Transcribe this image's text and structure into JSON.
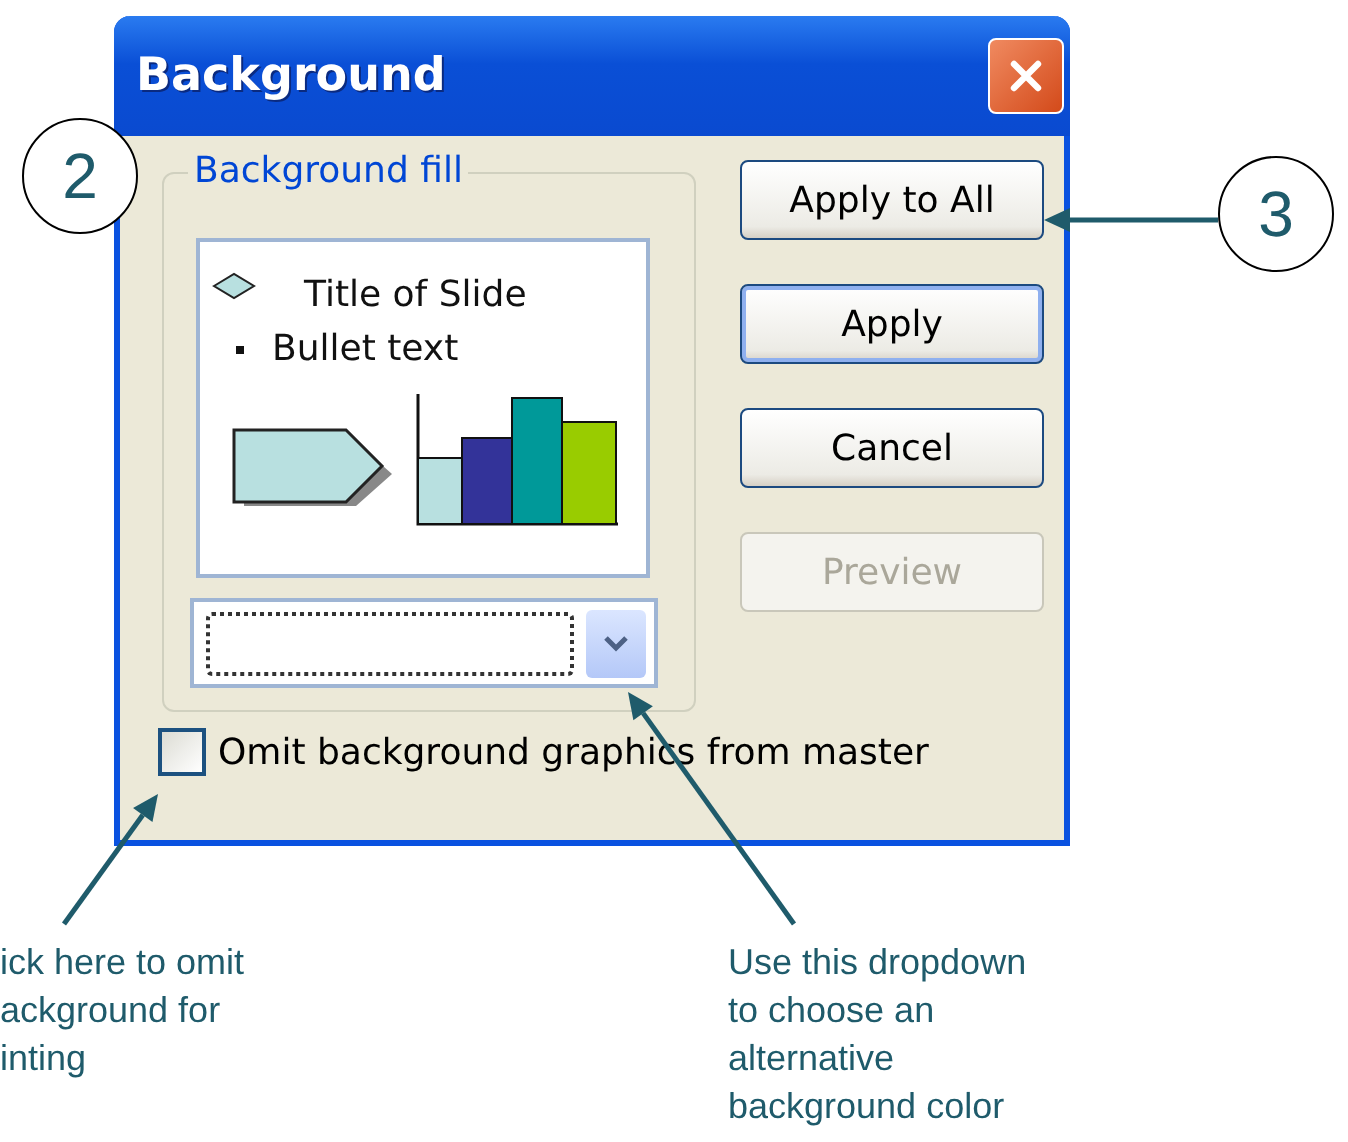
{
  "window": {
    "title": "Background"
  },
  "fill_group": {
    "label": "Background fill",
    "preview": {
      "title": "Title of Slide",
      "bullet": "Bullet text"
    }
  },
  "buttons": [
    {
      "label": "Apply to All",
      "default": false,
      "disabled": false
    },
    {
      "label": "Apply",
      "default": true,
      "disabled": false
    },
    {
      "label": "Cancel",
      "default": false,
      "disabled": false
    },
    {
      "label": "Preview",
      "default": false,
      "disabled": true
    }
  ],
  "omit_checkbox": {
    "label": "Omit background graphics from master",
    "checked": false
  },
  "callouts": [
    {
      "number": "2"
    },
    {
      "number": "3"
    }
  ],
  "notes": [
    {
      "text": "ick here to omit\nackground for\ninting"
    },
    {
      "text": "Use this dropdown\nto choose an\nalternative\nbackground color"
    }
  ]
}
